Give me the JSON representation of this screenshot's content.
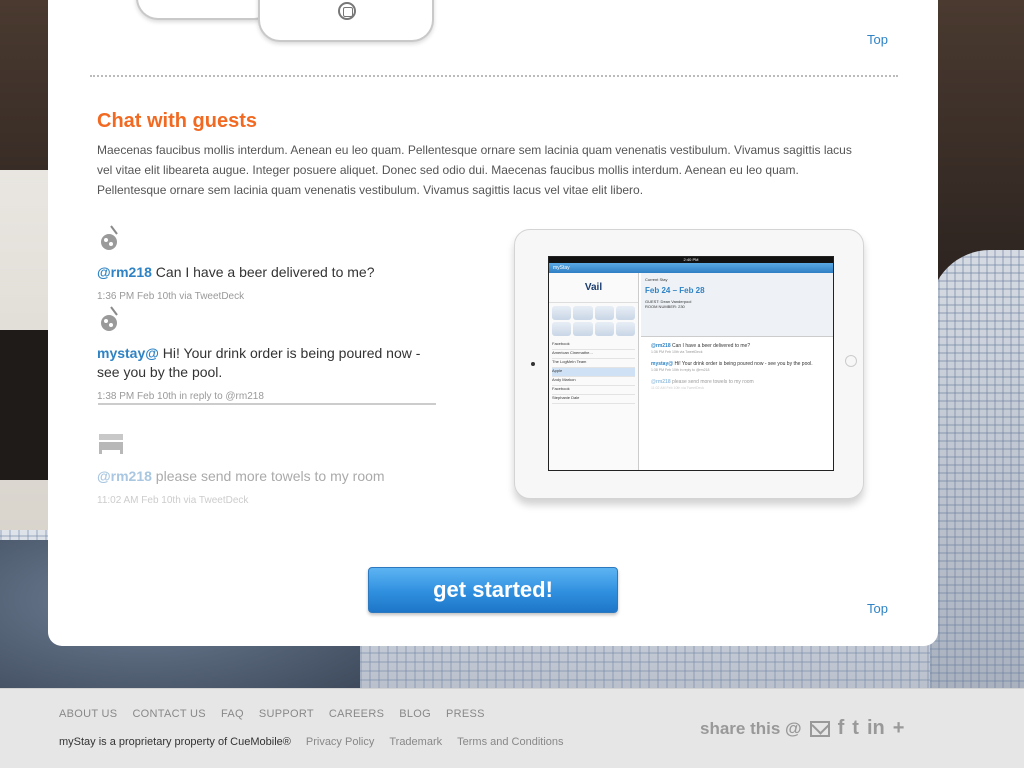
{
  "nav": {
    "top_label": "Top"
  },
  "chat": {
    "title": "Chat with guests",
    "body": "Maecenas faucibus mollis interdum. Aenean eu leo quam. Pellentesque ornare sem lacinia quam venenatis vestibulum. Vivamus sagittis lacus vel vitae elit libeareta augue. Integer posuere aliquet. Donec sed odio dui. Maecenas faucibus mollis interdum. Aenean eu leo quam. Pellentesque ornare sem lacinia quam venenatis vestibulum. Vivamus sagittis lacus vel vitae elit libero.",
    "tweets": [
      {
        "handle": "@rm218",
        "text": " Can I have a beer delivered to me?",
        "meta": "1:36 PM Feb 10th via TweetDeck"
      },
      {
        "handle": "mystay@",
        "text": " Hi! Your drink order is being poured now - see you by the pool.",
        "meta": "1:38 PM Feb 10th in reply to @rm218"
      },
      {
        "handle": "@rm218",
        "text": " please send more towels to my room",
        "meta": "11:02 AM Feb 10th via TweetDeck"
      }
    ]
  },
  "ipad": {
    "status": "2:40 PM",
    "app": "myStay",
    "logo": "Vail",
    "current_stay": "Current Stay",
    "dates": "Feb 24 – Feb 28",
    "guest": "GUEST: Dean Vanderpool",
    "room": "ROOM NUMBER: 230",
    "list": [
      "Facebook",
      "American Cinemathe...",
      "The LogMeIn Team",
      "Apple",
      "Andy Markon",
      "Facebook",
      "Stephanie Dale"
    ],
    "tweets": [
      {
        "handle": "@rm218",
        "text": " Can I have a beer delivered to me?",
        "meta": "1:36 PM Feb 10th via TweetDeck"
      },
      {
        "handle": "mystay@",
        "text": " Hi! Your drink order is being poured now - see you by the pool.",
        "meta": "1:38 PM Feb 10th in reply to @rm218"
      },
      {
        "handle": "@rm218",
        "text": " please send more towels to my room",
        "meta": "11:02 AM Feb 10th via TweetDeck"
      }
    ]
  },
  "cta": {
    "label": "get started!"
  },
  "footer": {
    "nav": [
      "ABOUT US",
      "CONTACT US",
      "FAQ",
      "SUPPORT",
      "CAREERS",
      "BLOG",
      "PRESS"
    ],
    "copyright": "myStay is a proprietary property of CueMobile®",
    "legal": [
      "Privacy Policy",
      "Trademark",
      "Terms and Conditions"
    ],
    "share_label": "share this @",
    "share_icons": [
      "mail-icon",
      "facebook-icon",
      "twitter-icon",
      "linkedin-icon",
      "plus-icon"
    ]
  },
  "colors": {
    "accent_orange": "#f26a22",
    "link_blue": "#2f83c5",
    "cta_blue": "#2f8fdf"
  }
}
